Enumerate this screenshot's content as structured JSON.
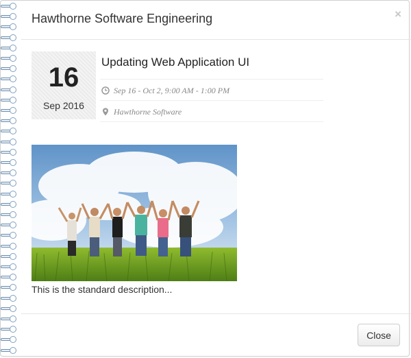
{
  "header": {
    "title": "Hawthorne Software Engineering",
    "close_glyph": "×"
  },
  "event": {
    "day": "16",
    "month_year": "Sep 2016",
    "title": "Updating Web Application UI",
    "time": "Sep 16 - Oct 2, 9:00 AM - 1:00 PM",
    "location": "Hawthorne Software",
    "description": "This is the standard description..."
  },
  "icons": {
    "time": "clock-icon",
    "location": "map-marker-icon",
    "close": "close-icon"
  },
  "footer": {
    "close_label": "Close"
  },
  "colors": {
    "spiral": "#7f9fbf",
    "meta_text": "#888888",
    "title_text": "#333333"
  }
}
